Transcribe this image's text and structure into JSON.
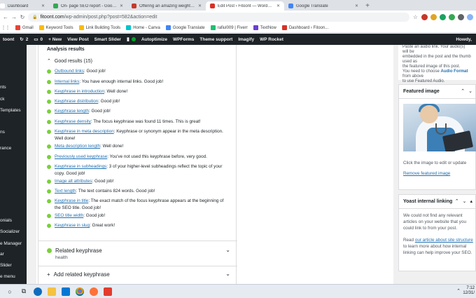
{
  "browser": {
    "tabs": [
      {
        "label": "Dashboard",
        "color": "#ffffff",
        "active": false
      },
      {
        "label": "On- page SEO report - Google S",
        "color": "#34a853",
        "active": false
      },
      {
        "label": "Offering an amazing weight los",
        "color": "#c53929",
        "active": false
      },
      {
        "label": "Edit Post ‹ Fitoont — WordPress",
        "color": "#d93025",
        "active": true
      },
      {
        "label": "Google Translate",
        "color": "#4285f4",
        "active": false
      }
    ],
    "new_tab_symbol": "+",
    "address": {
      "host": "fitoont.com",
      "path": "/wp-admin/post.php?post=582&action=edit"
    },
    "bookmarks": [
      {
        "label": "Gmail",
        "color": "#ea4335"
      },
      {
        "label": "Keyword Tools",
        "color": "#fbbc04"
      },
      {
        "label": "Link Building Tools",
        "color": "#fbbc04"
      },
      {
        "label": "Home - Canva",
        "color": "#00c4cc"
      },
      {
        "label": "Google Translate",
        "color": "#4285f4"
      },
      {
        "label": "rafiul009 | Fiverr",
        "color": "#1dbf73"
      },
      {
        "label": "TextNow",
        "color": "#6c3fd1"
      },
      {
        "label": "Dashboard ‹ Fitoon...",
        "color": "#d93025"
      }
    ]
  },
  "adminbar": {
    "items": [
      "toont",
      "2",
      "0",
      "+ New",
      "View Post",
      "Smart Slider",
      "",
      "Autoptimize",
      "WPForms",
      "Theme support",
      "Imagify",
      "WP Rocket"
    ],
    "howdy": "Howdy,"
  },
  "adminmenu": [
    "nts",
    "ck",
    "Templates",
    "ns",
    "rance",
    "onials",
    "Socializer",
    "e Manager",
    "ar",
    "Slider",
    "e menu"
  ],
  "analysis": {
    "title": "Analysis results",
    "good_toggle": "Good results (15)",
    "results": [
      {
        "link": "Outbound links",
        "text": ": Good job!"
      },
      {
        "link": "Internal links",
        "text": ": You have enough internal links. Good job!"
      },
      {
        "link": "Keyphrase in introduction",
        "text": ": Well done!"
      },
      {
        "link": "Keyphrase distribution",
        "text": ": Good job!"
      },
      {
        "link": "Keyphrase length",
        "text": ": Good job!"
      },
      {
        "link": "Keyphrase density",
        "text": ": The focus keyphrase was found 11 times. This is great!"
      },
      {
        "link": "Keyphrase in meta description",
        "text": ": Keyphrase or synonym appear in the meta description. Well done!"
      },
      {
        "link": "Meta description length",
        "text": ": Well done!"
      },
      {
        "link": "Previously used keyphrase",
        "text": ": You've not used this keyphrase before, very good."
      },
      {
        "link": "Keyphrase in subheadings",
        "text": ": 3 of your higher-level subheadings reflect the topic of your copy. Good job!"
      },
      {
        "link": "Image alt attributes",
        "text": ": Good job!"
      },
      {
        "link": "Text length",
        "text": ": The text contains 824 words. Good job!"
      },
      {
        "link": "Keyphrase in title",
        "text": ": The exact match of the focus keyphrase appears at the beginning of the SEO title. Good job!"
      },
      {
        "link": "SEO title width",
        "text": ": Good job!"
      },
      {
        "link": "Keyphrase in slug",
        "text": ": Great work!"
      }
    ],
    "related": {
      "title": "Related keyphrase",
      "sub": "health"
    },
    "add_related": "Add related keyphrase"
  },
  "sidebar": {
    "top_lines": [
      "Paste an audio link. Your audio(s) will be",
      "embedded in the post and the thumb used as",
      "the featured image of this post."
    ],
    "top_need": "You need to choose ",
    "top_link": "Audio Format",
    "top_rest": " from above",
    "top_last": "to use Featured Audio.",
    "featured": {
      "title": "Featured image",
      "caption": "Click the image to edit or update",
      "remove": "Remove featured image"
    },
    "internal": {
      "title": "Yoast internal linking",
      "p1": "We could not find any relevant articles on your website that you could link to from your post.",
      "p2_pre": "Read ",
      "p2_link": "our article about site structure",
      "p2_post": " to learn more about how internal linking can help improve your SEO."
    }
  },
  "taskbar": {
    "clock_time": "7:12",
    "clock_date": "12/31/"
  }
}
